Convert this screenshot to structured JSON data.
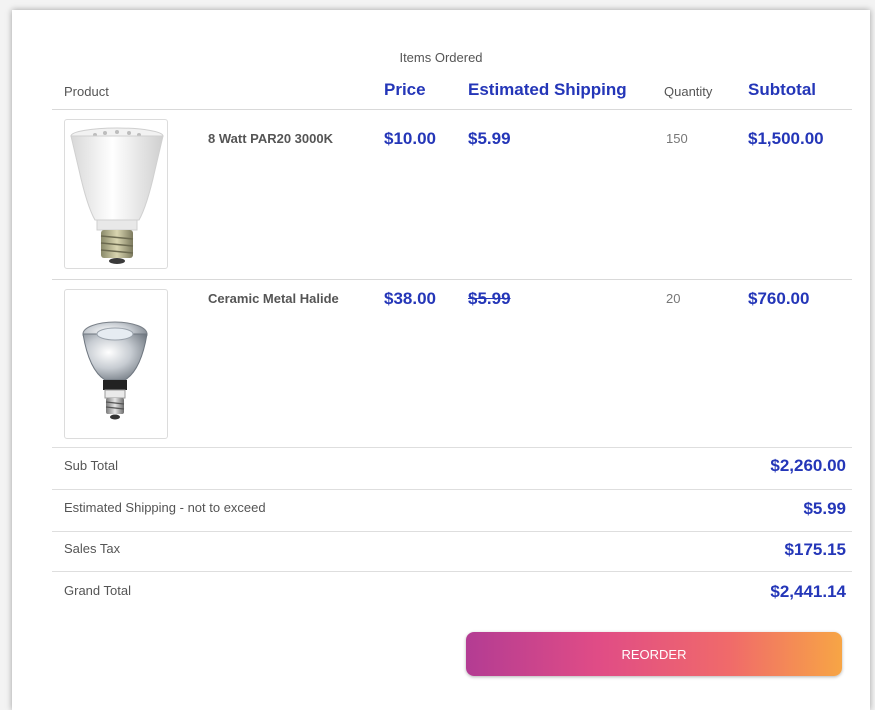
{
  "section_title": "Items Ordered",
  "columns": {
    "product": "Product",
    "price": "Price",
    "estimated_shipping": "Estimated Shipping",
    "quantity": "Quantity",
    "subtotal": "Subtotal"
  },
  "items": [
    {
      "name": "8 Watt PAR20 3000K",
      "price": "$10.00",
      "shipping": "$5.99",
      "shipping_struck": false,
      "quantity": "150",
      "subtotal": "$1,500.00",
      "image_icon": "led-par20-bulb-icon"
    },
    {
      "name": "Ceramic Metal Halide",
      "price": "$38.00",
      "shipping": "$5.99",
      "shipping_struck": true,
      "quantity": "20",
      "subtotal": "$760.00",
      "image_icon": "metal-halide-bulb-icon"
    }
  ],
  "summary": {
    "sub_total_label": "Sub Total",
    "sub_total_value": "$2,260.00",
    "shipping_label": "Estimated Shipping - not to exceed",
    "shipping_value": "$5.99",
    "tax_label": "Sales Tax",
    "tax_value": "$175.15",
    "grand_total_label": "Grand Total",
    "grand_total_value": "$2,441.14"
  },
  "reorder_label": "REORDER",
  "colors": {
    "accent_blue": "#2436b8",
    "button_gradient": [
      "#b33c93",
      "#e04c86",
      "#f06a6a",
      "#f7a545"
    ]
  }
}
